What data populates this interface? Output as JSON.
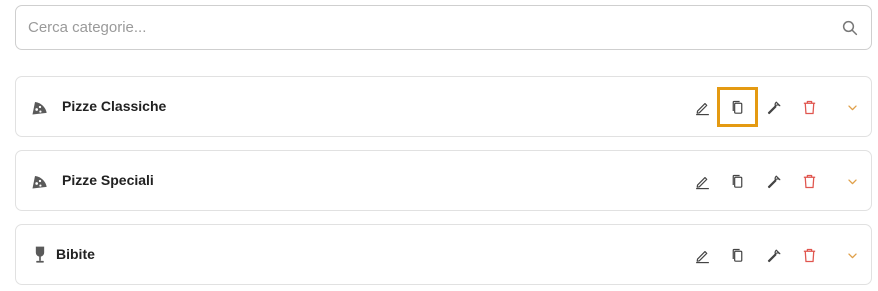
{
  "search": {
    "placeholder": "Cerca categorie..."
  },
  "categories": [
    {
      "name": "Pizze Classiche",
      "icon": "pizza-icon",
      "highlighted_action": "copy"
    },
    {
      "name": "Pizze Speciali",
      "icon": "pizza-icon"
    },
    {
      "name": "Bibite",
      "icon": "wine-glass-icon"
    }
  ],
  "colors": {
    "delete": "#e0564f",
    "expand": "#e0a04a",
    "highlight": "#e49a12",
    "icon": "#444444"
  }
}
